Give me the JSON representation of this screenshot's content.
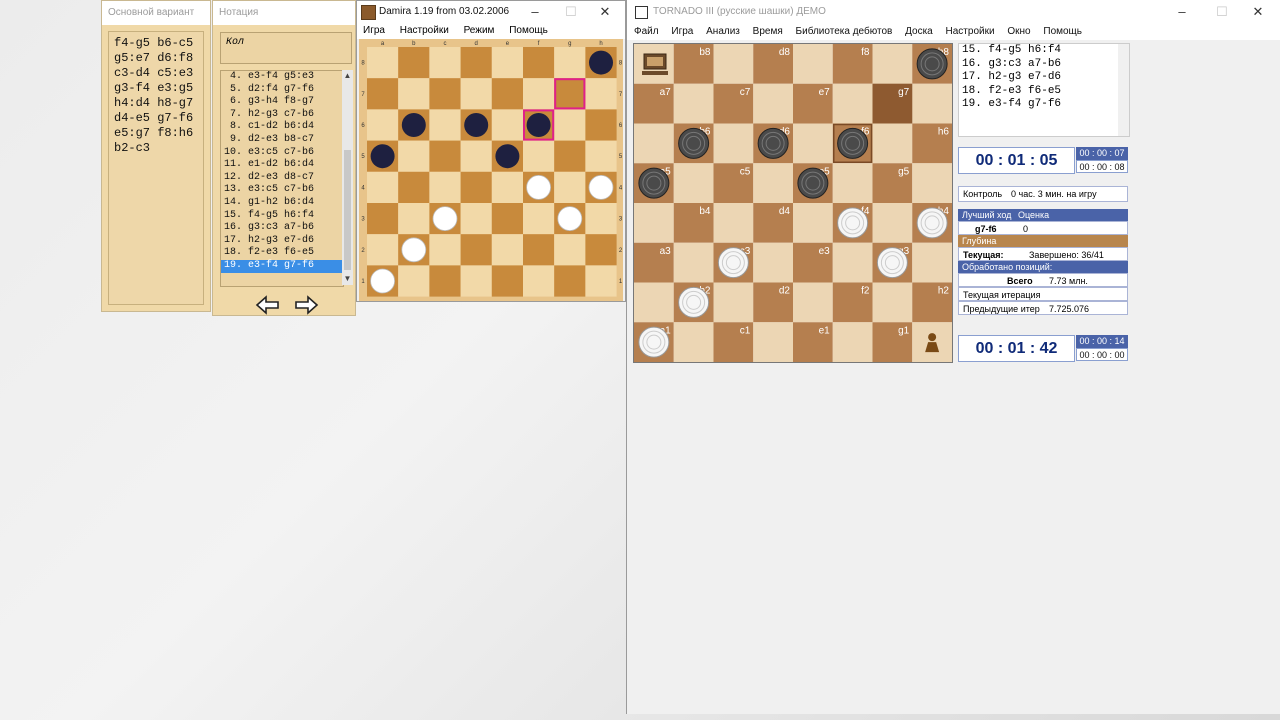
{
  "variant_window": {
    "title": "Основной вариант",
    "moves_text": "f4-g5 b6-c5\ng5:e7 d6:f8\nc3-d4 c5:e3\ng3-f4 e3:g5\nh4:d4 h8-g7\nd4-e5 g7-f6\ne5:g7 f8:h6\nb2-c3"
  },
  "notation_window": {
    "title": "Нотация",
    "header_label": "Кол",
    "rows": [
      " 4. e3-f4 g5:e3",
      " 5. d2:f4 g7-f6",
      " 6. g3-h4 f8-g7",
      " 7. h2-g3 c7-b6",
      " 8. c1-d2 b6:d4",
      " 9. d2-e3 b8-c7",
      "10. e3:c5 c7-b6",
      "11. e1-d2 b6:d4",
      "12. d2-e3 d8-c7",
      "13. e3:c5 c7-b6",
      "14. g1-h2 b6:d4",
      "15. f4-g5 h6:f4",
      "16. g3:c3 a7-b6",
      "17. h2-g3 e7-d6",
      "18. f2-e3 f6-e5",
      "19. e3-f4 g7-f6"
    ],
    "selected_index": 15
  },
  "damira_window": {
    "title": "Damira 1.19 from 03.02.2006",
    "menu": [
      "Игра",
      "Настройки",
      "Режим",
      "Помощь"
    ],
    "files": [
      "a",
      "b",
      "c",
      "d",
      "e",
      "f",
      "g",
      "h"
    ],
    "ranks": [
      "8",
      "7",
      "6",
      "5",
      "4",
      "3",
      "2",
      "1"
    ],
    "black_pieces": [
      "h8",
      "b6",
      "d6",
      "f6",
      "a5",
      "e5"
    ],
    "white_pieces": [
      "f4",
      "h4",
      "c3",
      "g3",
      "b2",
      "a1"
    ],
    "highlighted": [
      "g7",
      "f6"
    ]
  },
  "tornado_window": {
    "title": "TORNADO III (русские шашки) ДЕМО",
    "menu": [
      "Файл",
      "Игра",
      "Анализ",
      "Время",
      "Библиотека дебютов",
      "Доска",
      "Настройки",
      "Окно",
      "Помощь"
    ],
    "square_labels": [
      "b8",
      "d8",
      "f8",
      "h8",
      "a7",
      "c7",
      "e7",
      "g7",
      "b6",
      "d6",
      "f6",
      "h6",
      "a5",
      "c5",
      "e5",
      "g5",
      "b4",
      "d4",
      "f4",
      "h4",
      "a3",
      "c3",
      "e3",
      "g3",
      "b2",
      "d2",
      "f2",
      "h2",
      "a1",
      "c1",
      "e1",
      "g1"
    ],
    "black_pieces": [
      "h8",
      "b6",
      "d6",
      "f6",
      "a5",
      "e5"
    ],
    "white_pieces": [
      "f4",
      "h4",
      "c3",
      "g3",
      "b2",
      "a1"
    ],
    "last_move": [
      "g7",
      "f6"
    ],
    "move_list": [
      "15. f4-g5 h6:f4",
      "16. g3:c3 a7-b6",
      "17. h2-g3 e7-d6",
      "18. f2-e3 f6-e5",
      "19. e3-f4 g7-f6"
    ],
    "timer_top": "00 : 01 : 05",
    "timer_top_small": [
      "00 : 00 : 07",
      "00 : 00 : 08"
    ],
    "control_label": "Контроль",
    "control_value": "0 час. 3 мин. на игру",
    "best_move_label": "Лучший ход",
    "score_label": "Оценка",
    "best_move": "g7-f6",
    "score": "0",
    "depth_label": "Глубина",
    "current_label": "Текущая:",
    "completed": "Завершено: 36/41",
    "processed_label": "Обработано позиций:",
    "total_label": "Всего",
    "total_value": "7.73 млн.",
    "iter_label": "Текущая итерация",
    "iter_value": "",
    "prev_iter_label": "Предыдущие итер",
    "prev_iter_value": "7.725.076",
    "timer_bottom": "00 : 01 : 42",
    "timer_bottom_small": [
      "00 : 00 : 14",
      "00 : 00 : 00"
    ]
  },
  "colors": {
    "dark_square_damira": "#c88a3c",
    "light_square_damira": "#f2d9a8",
    "dark_square_tornado": "#b57f4f",
    "light_square_tornado": "#ecd6b4",
    "black_piece_damira": "#1e2040",
    "accent_blue": "#4a63a8"
  }
}
